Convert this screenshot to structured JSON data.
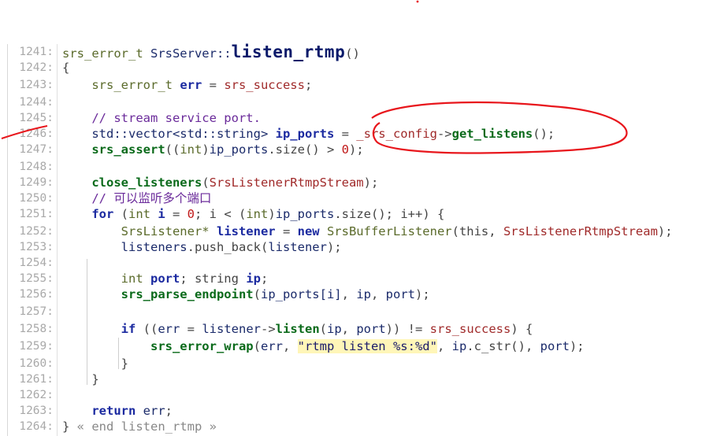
{
  "editor": {
    "lines": [
      {
        "n": "1241:",
        "segs": [
          [
            "ty",
            "srs_error_t "
          ],
          [
            "id",
            "SrsServer::"
          ],
          [
            "big",
            "listen_rtmp"
          ],
          [
            "op",
            "()"
          ]
        ]
      },
      {
        "n": "1242:",
        "segs": [
          [
            "op",
            "{"
          ]
        ]
      },
      {
        "n": "1243:",
        "segs": [
          [
            "",
            "    "
          ],
          [
            "ty",
            "srs_error_t "
          ],
          [
            "kw",
            "err"
          ],
          [
            "op",
            " = "
          ],
          [
            "cls",
            "srs_success"
          ],
          [
            "op",
            ";"
          ]
        ]
      },
      {
        "n": "1244:",
        "segs": []
      },
      {
        "n": "1245:",
        "segs": [
          [
            "",
            "    "
          ],
          [
            "cm",
            "// stream service port."
          ]
        ]
      },
      {
        "n": "1246:",
        "segs": [
          [
            "",
            "    "
          ],
          [
            "id",
            "std::vector<std::string> "
          ],
          [
            "kw",
            "ip_ports"
          ],
          [
            "op",
            " = "
          ],
          [
            "cls",
            "_srs_config"
          ],
          [
            "op",
            "->"
          ],
          [
            "fn",
            "get_listens"
          ],
          [
            "op",
            "();"
          ]
        ]
      },
      {
        "n": "1247:",
        "segs": [
          [
            "",
            "    "
          ],
          [
            "fn",
            "srs_assert"
          ],
          [
            "op",
            "(("
          ],
          [
            "ty",
            "int"
          ],
          [
            "op",
            ")"
          ],
          [
            "id",
            "ip_ports"
          ],
          [
            "op",
            ".size() > "
          ],
          [
            "num-lit",
            "0"
          ],
          [
            "op",
            ");"
          ]
        ]
      },
      {
        "n": "1248:",
        "segs": []
      },
      {
        "n": "1249:",
        "segs": [
          [
            "",
            "    "
          ],
          [
            "fn",
            "close_listeners"
          ],
          [
            "op",
            "("
          ],
          [
            "cls",
            "SrsListenerRtmpStream"
          ],
          [
            "op",
            ");"
          ]
        ]
      },
      {
        "n": "1250:",
        "segs": [
          [
            "",
            "    "
          ],
          [
            "cm",
            "// 可以监听多个端口"
          ]
        ]
      },
      {
        "n": "1251:",
        "segs": [
          [
            "",
            "    "
          ],
          [
            "kw",
            "for"
          ],
          [
            "op",
            " ("
          ],
          [
            "ty",
            "int "
          ],
          [
            "kw",
            "i"
          ],
          [
            "op",
            " = "
          ],
          [
            "num-lit",
            "0"
          ],
          [
            "op",
            "; i < ("
          ],
          [
            "ty",
            "int"
          ],
          [
            "op",
            ")"
          ],
          [
            "id",
            "ip_ports"
          ],
          [
            "op",
            ".size(); i++) {"
          ]
        ]
      },
      {
        "n": "1252:",
        "segs": [
          [
            "",
            "        "
          ],
          [
            "ty",
            "SrsListener* "
          ],
          [
            "kw",
            "listener"
          ],
          [
            "op",
            " = "
          ],
          [
            "kw",
            "new "
          ],
          [
            "ty",
            "SrsBufferListener"
          ],
          [
            "op",
            "(this, "
          ],
          [
            "cls",
            "SrsListenerRtmpStream"
          ],
          [
            "op",
            ");"
          ]
        ]
      },
      {
        "n": "1253:",
        "segs": [
          [
            "",
            "        "
          ],
          [
            "id",
            "listeners"
          ],
          [
            "op",
            ".push_back("
          ],
          [
            "id",
            "listener"
          ],
          [
            "op",
            ");"
          ]
        ]
      },
      {
        "n": "1254:",
        "segs": []
      },
      {
        "n": "1255:",
        "segs": [
          [
            "",
            "        "
          ],
          [
            "ty",
            "int "
          ],
          [
            "kw",
            "port"
          ],
          [
            "op",
            "; string "
          ],
          [
            "kw",
            "ip"
          ],
          [
            "op",
            ";"
          ]
        ]
      },
      {
        "n": "1256:",
        "segs": [
          [
            "",
            "        "
          ],
          [
            "fn",
            "srs_parse_endpoint"
          ],
          [
            "op",
            "("
          ],
          [
            "id",
            "ip_ports[i]"
          ],
          [
            "op",
            ", "
          ],
          [
            "id",
            "ip"
          ],
          [
            "op",
            ", "
          ],
          [
            "id",
            "port"
          ],
          [
            "op",
            ");"
          ]
        ]
      },
      {
        "n": "1257:",
        "segs": []
      },
      {
        "n": "1258:",
        "segs": [
          [
            "",
            "        "
          ],
          [
            "kw",
            "if"
          ],
          [
            "op",
            " (("
          ],
          [
            "id",
            "err"
          ],
          [
            "op",
            " = "
          ],
          [
            "id",
            "listener"
          ],
          [
            "op",
            "->"
          ],
          [
            "fn",
            "listen"
          ],
          [
            "op",
            "("
          ],
          [
            "id",
            "ip"
          ],
          [
            "op",
            ", "
          ],
          [
            "id",
            "port"
          ],
          [
            "op",
            ")) != "
          ],
          [
            "cls",
            "srs_success"
          ],
          [
            "op",
            ") {"
          ]
        ]
      },
      {
        "n": "1259:",
        "segs": [
          [
            "",
            "            "
          ],
          [
            "fn",
            "srs_error_wrap"
          ],
          [
            "op",
            "("
          ],
          [
            "id",
            "err"
          ],
          [
            "op",
            ", "
          ],
          [
            "str",
            "\"rtmp listen %s:%d\""
          ],
          [
            "op",
            ", "
          ],
          [
            "id",
            "ip"
          ],
          [
            "op",
            ".c_str(), "
          ],
          [
            "id",
            "port"
          ],
          [
            "op",
            ");"
          ]
        ]
      },
      {
        "n": "1260:",
        "segs": [
          [
            "",
            "        "
          ],
          [
            "op",
            "}"
          ]
        ]
      },
      {
        "n": "1261:",
        "segs": [
          [
            "",
            "    "
          ],
          [
            "op",
            "}"
          ]
        ]
      },
      {
        "n": "1262:",
        "segs": []
      },
      {
        "n": "1263:",
        "segs": [
          [
            "",
            "    "
          ],
          [
            "kw",
            "return "
          ],
          [
            "id",
            "err"
          ],
          [
            "op",
            ";"
          ]
        ]
      },
      {
        "n": "1264:",
        "segs": [
          [
            "op",
            "} "
          ],
          [
            "dim",
            "« end listen_rtmp »"
          ]
        ]
      }
    ]
  },
  "colors": {
    "annotation": "#e8161c"
  }
}
